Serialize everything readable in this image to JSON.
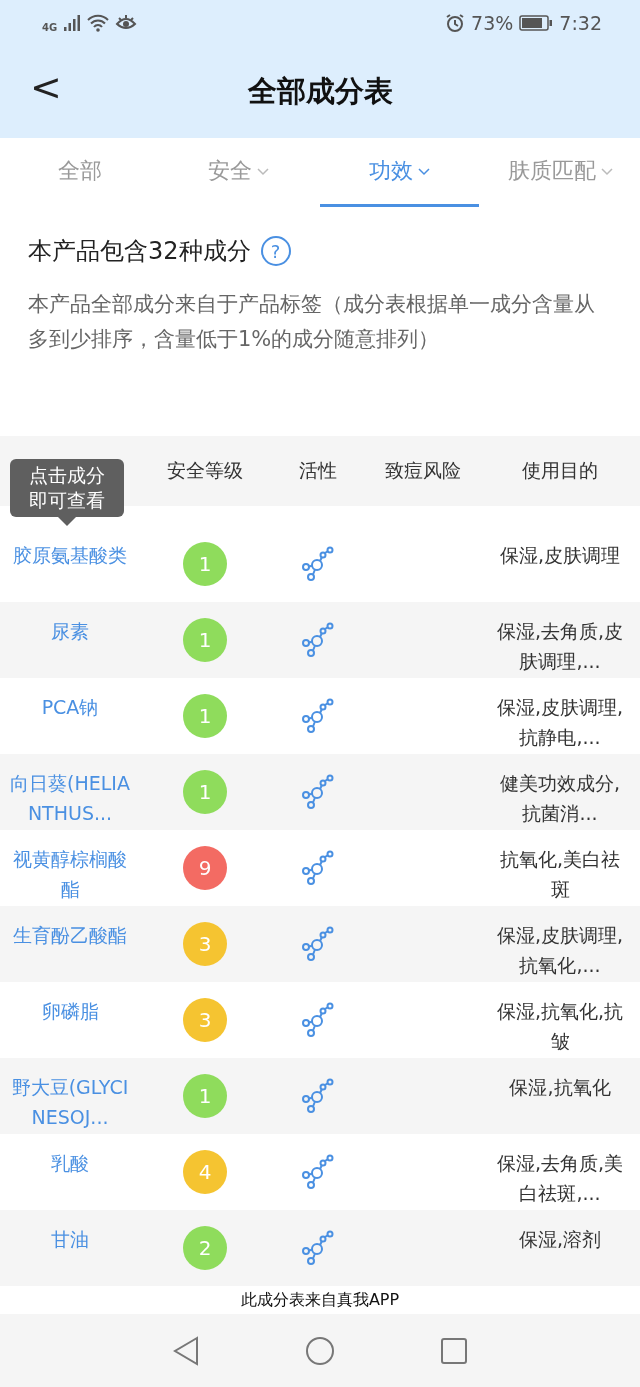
{
  "status_bar": {
    "network": "4G",
    "battery": "73%",
    "time": "7:32"
  },
  "header": {
    "back": "<",
    "title": "全部成分表"
  },
  "tabs": [
    {
      "label": "全部",
      "dropdown": false,
      "selected": false
    },
    {
      "label": "安全",
      "dropdown": true,
      "selected": false
    },
    {
      "label": "功效",
      "dropdown": true,
      "selected": true
    },
    {
      "label": "肤质匹配",
      "dropdown": true,
      "selected": false
    }
  ],
  "summary": {
    "title": "本产品包含32种成分",
    "help": "?",
    "description": "本产品全部成分来自于产品标签（成分表根据单一成分含量从多到少排序，含量低于1%的成分随意排列）"
  },
  "table": {
    "columns": [
      "安全等级",
      "活性",
      "致痘风险",
      "使用目的"
    ],
    "tooltip": "点击成分即可查看",
    "rows": [
      {
        "name": "胶原氨基酸类",
        "grade": "1",
        "color": "#8fdc5c",
        "purpose": "保湿,皮肤调理"
      },
      {
        "name": "尿素",
        "grade": "1",
        "color": "#8fdc5c",
        "purpose": "保湿,去角质,皮肤调理,..."
      },
      {
        "name": "PCA钠",
        "grade": "1",
        "color": "#8fdc5c",
        "purpose": "保湿,皮肤调理,抗静电,..."
      },
      {
        "name": "向日葵(HELIANTHUS...",
        "grade": "1",
        "color": "#8fdc5c",
        "purpose": "健美功效成分,抗菌消..."
      },
      {
        "name": "视黄醇棕榈酸酯",
        "grade": "9",
        "color": "#f36b63",
        "purpose": "抗氧化,美白祛斑"
      },
      {
        "name": "生育酚乙酸酯",
        "grade": "3",
        "color": "#f5c431",
        "purpose": "保湿,皮肤调理,抗氧化,..."
      },
      {
        "name": "卵磷脂",
        "grade": "3",
        "color": "#f5c431",
        "purpose": "保湿,抗氧化,抗皱"
      },
      {
        "name": "野大豆(GLYCINESOJ...",
        "grade": "1",
        "color": "#8fdc5c",
        "purpose": "保湿,抗氧化"
      },
      {
        "name": "乳酸",
        "grade": "4",
        "color": "#f5c431",
        "purpose": "保湿,去角质,美白祛斑,..."
      },
      {
        "name": "甘油",
        "grade": "2",
        "color": "#8fdc5c",
        "purpose": "保湿,溶剂"
      }
    ]
  },
  "footer": "此成分表来自真我APP"
}
